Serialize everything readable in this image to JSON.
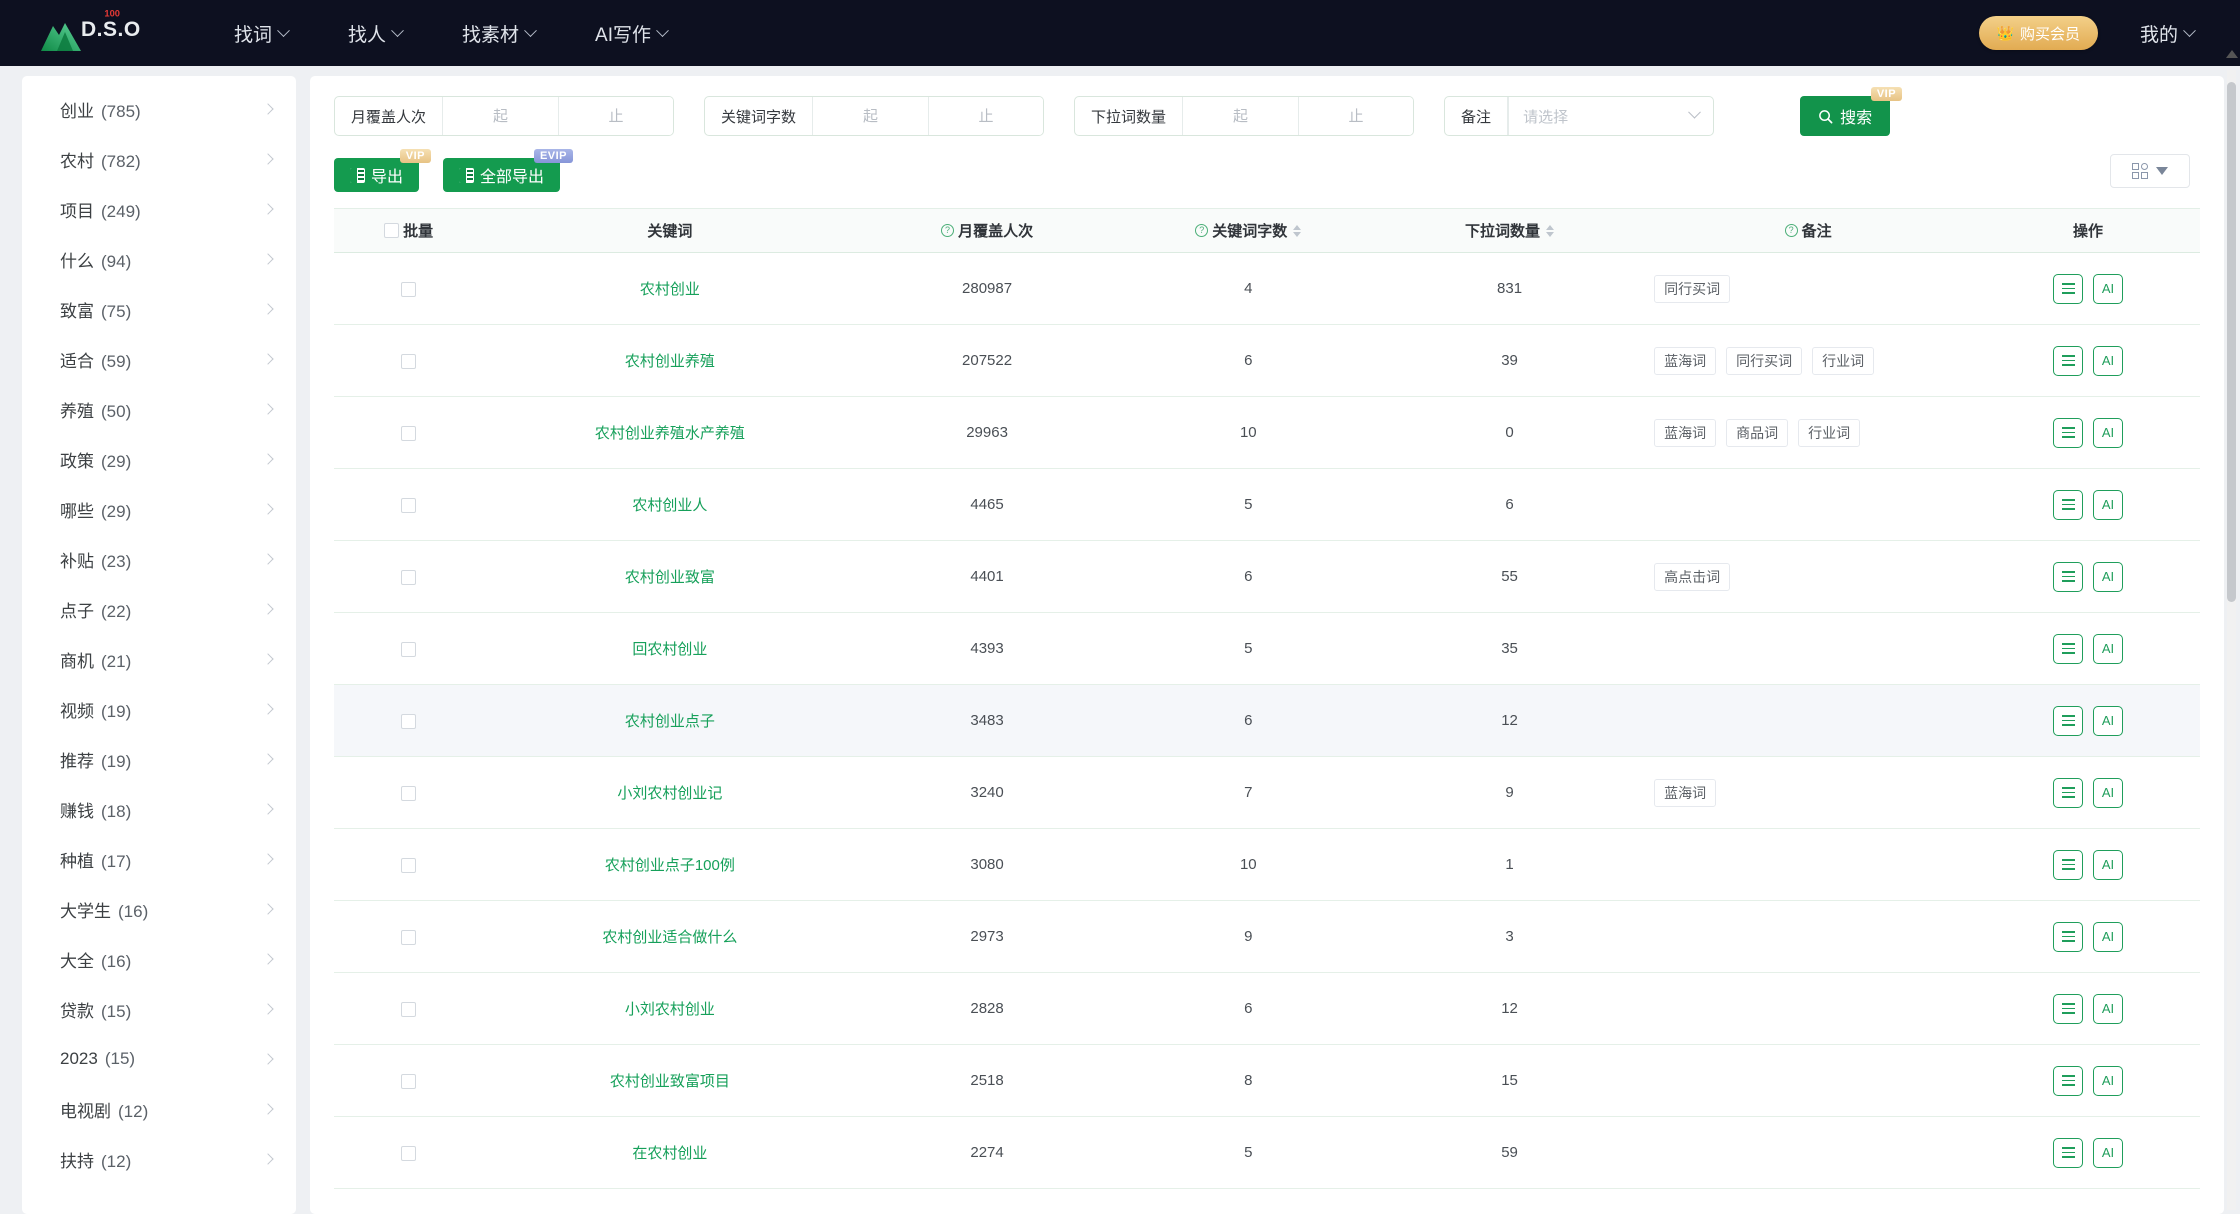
{
  "header": {
    "logo_text": "D.S.O",
    "logo_badge": "100",
    "nav": [
      {
        "label": "找词"
      },
      {
        "label": "找人"
      },
      {
        "label": "找素材"
      },
      {
        "label": "AI写作"
      }
    ],
    "vip_button": "购买会员",
    "account": "我的"
  },
  "sidebar": {
    "items": [
      {
        "label": "创业",
        "count": "(785)"
      },
      {
        "label": "农村",
        "count": "(782)"
      },
      {
        "label": "项目",
        "count": "(249)"
      },
      {
        "label": "什么",
        "count": "(94)"
      },
      {
        "label": "致富",
        "count": "(75)"
      },
      {
        "label": "适合",
        "count": "(59)"
      },
      {
        "label": "养殖",
        "count": "(50)"
      },
      {
        "label": "政策",
        "count": "(29)"
      },
      {
        "label": "哪些",
        "count": "(29)"
      },
      {
        "label": "补贴",
        "count": "(23)"
      },
      {
        "label": "点子",
        "count": "(22)"
      },
      {
        "label": "商机",
        "count": "(21)"
      },
      {
        "label": "视频",
        "count": "(19)"
      },
      {
        "label": "推荐",
        "count": "(19)"
      },
      {
        "label": "赚钱",
        "count": "(18)"
      },
      {
        "label": "种植",
        "count": "(17)"
      },
      {
        "label": "大学生",
        "count": "(16)"
      },
      {
        "label": "大全",
        "count": "(16)"
      },
      {
        "label": "贷款",
        "count": "(15)"
      },
      {
        "label": "2023",
        "count": "(15)"
      },
      {
        "label": "电视剧",
        "count": "(12)"
      },
      {
        "label": "扶持",
        "count": "(12)"
      }
    ]
  },
  "filters": {
    "ranges": [
      {
        "label": "月覆盖人次",
        "from_placeholder": "起",
        "to_placeholder": "止",
        "from_value": "",
        "to_value": ""
      },
      {
        "label": "关键词字数",
        "from_placeholder": "起",
        "to_placeholder": "止",
        "from_value": "",
        "to_value": ""
      },
      {
        "label": "下拉词数量",
        "from_placeholder": "起",
        "to_placeholder": "止",
        "from_value": "",
        "to_value": ""
      }
    ],
    "select": {
      "label": "备注",
      "placeholder": "请选择",
      "value": ""
    },
    "search_button": "搜索",
    "search_badge": "VIP"
  },
  "toolbar": {
    "export_label": "导出",
    "export_badge": "VIP",
    "export_all_label": "全部导出",
    "export_all_badge": "EVIP"
  },
  "table": {
    "columns": {
      "batch": "批量",
      "keyword": "关键词",
      "monthly": "月覆盖人次",
      "wordcount": "关键词字数",
      "suggest": "下拉词数量",
      "note": "备注",
      "action": "操作"
    },
    "rows": [
      {
        "keyword": "农村创业",
        "monthly": "280987",
        "wordcount": "4",
        "suggest": "831",
        "tags": [
          "同行买词"
        ],
        "highlight": false
      },
      {
        "keyword": "农村创业养殖",
        "monthly": "207522",
        "wordcount": "6",
        "suggest": "39",
        "tags": [
          "蓝海词",
          "同行买词",
          "行业词"
        ],
        "highlight": false
      },
      {
        "keyword": "农村创业养殖水产养殖",
        "monthly": "29963",
        "wordcount": "10",
        "suggest": "0",
        "tags": [
          "蓝海词",
          "商品词",
          "行业词"
        ],
        "highlight": false
      },
      {
        "keyword": "农村创业人",
        "monthly": "4465",
        "wordcount": "5",
        "suggest": "6",
        "tags": [],
        "highlight": false
      },
      {
        "keyword": "农村创业致富",
        "monthly": "4401",
        "wordcount": "6",
        "suggest": "55",
        "tags": [
          "高点击词"
        ],
        "highlight": false
      },
      {
        "keyword": "回农村创业",
        "monthly": "4393",
        "wordcount": "5",
        "suggest": "35",
        "tags": [],
        "highlight": false
      },
      {
        "keyword": "农村创业点子",
        "monthly": "3483",
        "wordcount": "6",
        "suggest": "12",
        "tags": [],
        "highlight": true
      },
      {
        "keyword": "小刘农村创业记",
        "monthly": "3240",
        "wordcount": "7",
        "suggest": "9",
        "tags": [
          "蓝海词"
        ],
        "highlight": false
      },
      {
        "keyword": "农村创业点子100例",
        "monthly": "3080",
        "wordcount": "10",
        "suggest": "1",
        "tags": [],
        "highlight": false
      },
      {
        "keyword": "农村创业适合做什么",
        "monthly": "2973",
        "wordcount": "9",
        "suggest": "3",
        "tags": [],
        "highlight": false
      },
      {
        "keyword": "小刘农村创业",
        "monthly": "2828",
        "wordcount": "6",
        "suggest": "12",
        "tags": [],
        "highlight": false
      },
      {
        "keyword": "农村创业致富项目",
        "monthly": "2518",
        "wordcount": "8",
        "suggest": "15",
        "tags": [],
        "highlight": false
      },
      {
        "keyword": "在农村创业",
        "monthly": "2274",
        "wordcount": "5",
        "suggest": "59",
        "tags": [],
        "highlight": false
      }
    ],
    "op_list_label": "",
    "op_ai_label": "AI"
  },
  "colors": {
    "brand_green": "#12934b",
    "link_green": "#16a05a",
    "vip_gold": "#e2ab52",
    "navy": "#0d1020"
  }
}
